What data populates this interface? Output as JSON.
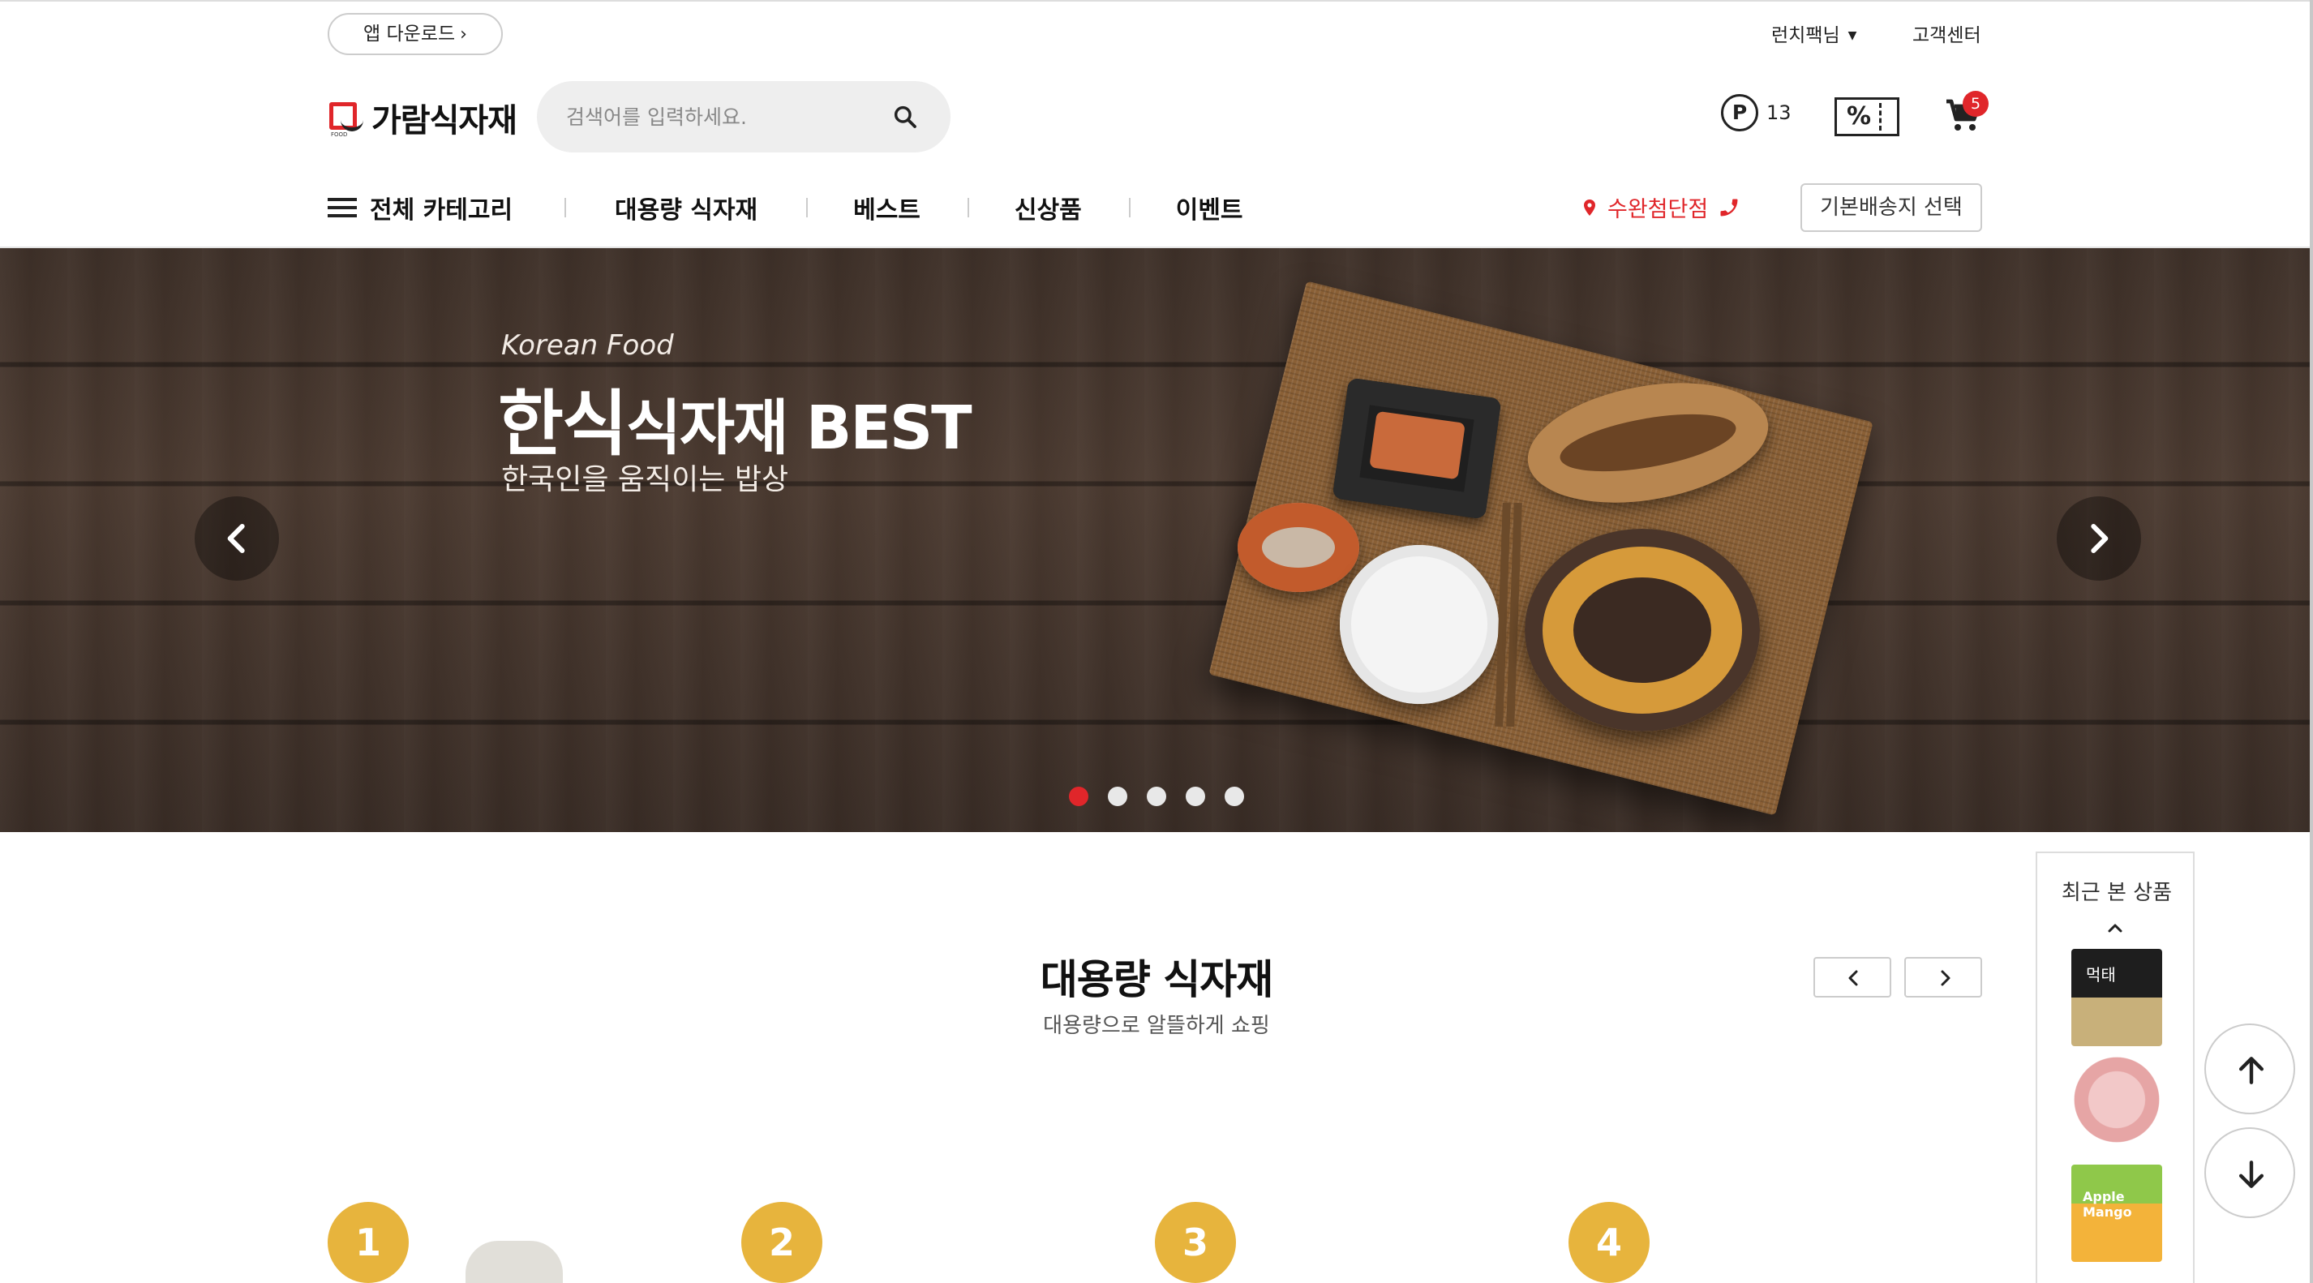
{
  "topbar": {
    "app_download": "앱 다운로드",
    "user_menu": "런치팩님",
    "customer_center": "고객센터"
  },
  "header": {
    "logo_text": "가람식자재",
    "logo_sub": "FOOD",
    "search_placeholder": "검색어를 입력하세요.",
    "points": "13",
    "point_symbol": "P",
    "coupon_symbol": "%",
    "cart_count": "5"
  },
  "nav": {
    "all_categories": "전체 카테고리",
    "items": [
      "대용량 식자재",
      "베스트",
      "신상품",
      "이벤트"
    ],
    "store": "수완첨단점",
    "address_button": "기본배송지 선택"
  },
  "hero": {
    "subtitle": "Korean Food",
    "title_main": "한식",
    "title_rest": "식자재 BEST",
    "description": "한국인을 움직이는 밥상",
    "slides": 5,
    "active_slide": 1
  },
  "section": {
    "title": "대용량 식자재",
    "subtitle": "대용량으로 알뜰하게 쇼핑",
    "ranks": [
      "1",
      "2",
      "3",
      "4"
    ]
  },
  "recent": {
    "title": "최근 본 상품",
    "thumb1_label": "먹태",
    "thumb3_label": "Apple Mango"
  },
  "colors": {
    "accent": "#e0262a",
    "rank_badge": "#e7b43d"
  },
  "icons": [
    "search-icon",
    "point-icon",
    "coupon-icon",
    "cart-icon",
    "menu-icon",
    "location-pin-icon",
    "phone-icon",
    "chevron-left-icon",
    "chevron-right-icon",
    "arrow-up-icon",
    "arrow-down-icon"
  ]
}
